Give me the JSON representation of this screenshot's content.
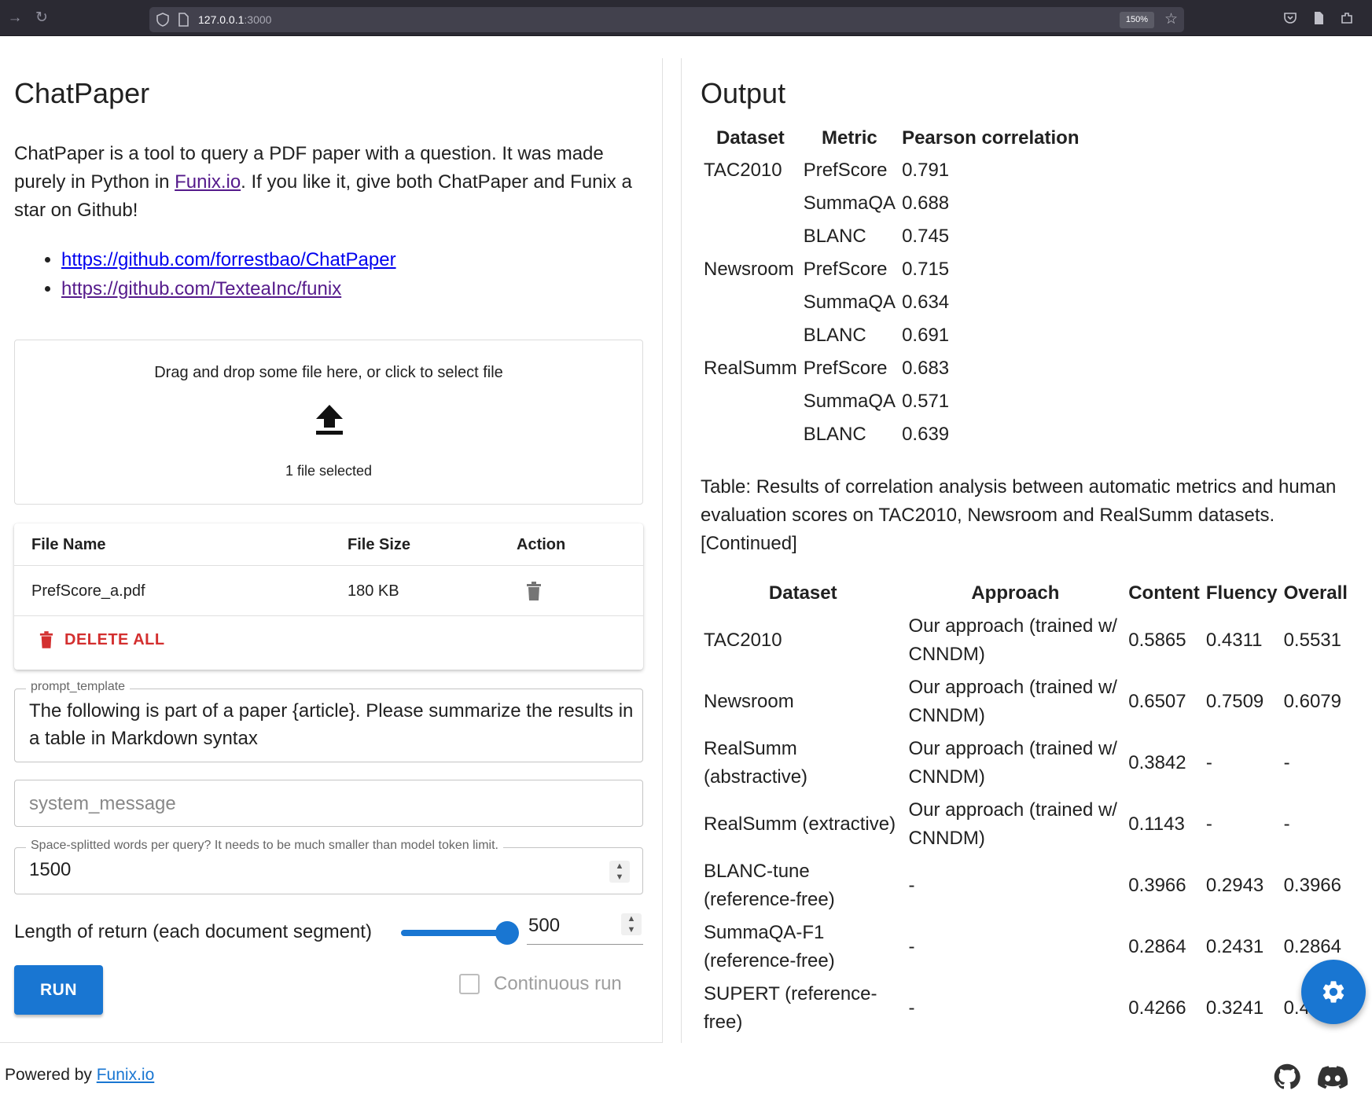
{
  "browser": {
    "url_host": "127.0.0.1",
    "url_port": ":3000",
    "zoom": "150%"
  },
  "left": {
    "title": "ChatPaper",
    "desc_before": "ChatPaper is a tool to query a PDF paper with a question. It was made purely in Python in ",
    "desc_link": "Funix.io",
    "desc_after": ". If you like it, give both ChatPaper and Funix a star on Github!",
    "links": [
      "https://github.com/forrestbao/ChatPaper",
      "https://github.com/TexteaInc/funix"
    ],
    "dropzone_text": "Drag and drop some file here, or click to select file",
    "dropzone_count": "1 file selected",
    "file_table": {
      "headers": [
        "File Name",
        "File Size",
        "Action"
      ],
      "rows": [
        {
          "name": "PrefScore_a.pdf",
          "size": "180 KB"
        }
      ],
      "delete_all": "DELETE ALL"
    },
    "prompt_label": "prompt_template",
    "prompt_value": "The following is part of a paper {article}. Please summarize the results in a table in Markdown syntax",
    "system_placeholder": "system_message",
    "words_label": "Space-splitted words per query? It needs to be much smaller than model token limit.",
    "words_value": "1500",
    "slider_label": "Length of return (each document segment)",
    "slider_value": "500",
    "run_label": "RUN",
    "continuous_label": "Continuous run"
  },
  "footer": {
    "powered": "Powered by ",
    "link": "Funix.io"
  },
  "output": {
    "title": "Output",
    "table1": {
      "headers": [
        "Dataset",
        "Metric",
        "Pearson correlation"
      ],
      "rows": [
        [
          "TAC2010",
          "PrefScore",
          "0.791"
        ],
        [
          "",
          "SummaQA",
          "0.688"
        ],
        [
          "",
          "BLANC",
          "0.745"
        ],
        [
          "Newsroom",
          "PrefScore",
          "0.715"
        ],
        [
          "",
          "SummaQA",
          "0.634"
        ],
        [
          "",
          "BLANC",
          "0.691"
        ],
        [
          "RealSumm",
          "PrefScore",
          "0.683"
        ],
        [
          "",
          "SummaQA",
          "0.571"
        ],
        [
          "",
          "BLANC",
          "0.639"
        ]
      ]
    },
    "caption": "Table: Results of correlation analysis between automatic metrics and human evaluation scores on TAC2010, Newsroom and RealSumm datasets. [Continued]",
    "table2": {
      "headers": [
        "Dataset",
        "Approach",
        "Content",
        "Fluency",
        "Overall"
      ],
      "rows": [
        [
          "TAC2010",
          "Our approach (trained w/ CNNDM)",
          "0.5865",
          "0.4311",
          "0.5531"
        ],
        [
          "Newsroom",
          "Our approach (trained w/ CNNDM)",
          "0.6507",
          "0.7509",
          "0.6079"
        ],
        [
          "RealSumm (abstractive)",
          "Our approach (trained w/ CNNDM)",
          "0.3842",
          "-",
          "-"
        ],
        [
          "RealSumm (extractive)",
          "Our approach (trained w/ CNNDM)",
          "0.1143",
          "-",
          "-"
        ],
        [
          "BLANC-tune (reference-free)",
          "-",
          "0.3966",
          "0.2943",
          "0.3966"
        ],
        [
          "SummaQA-F1 (reference-free)",
          "-",
          "0.2864",
          "0.2431",
          "0.2864"
        ],
        [
          "SUPERT (reference-free)",
          "-",
          "0.4266",
          "0.3241",
          "0.4"
        ]
      ]
    }
  },
  "colors": {
    "primary": "#1976d2",
    "danger": "#d32f2f",
    "browser_bg": "#2b2a33"
  }
}
